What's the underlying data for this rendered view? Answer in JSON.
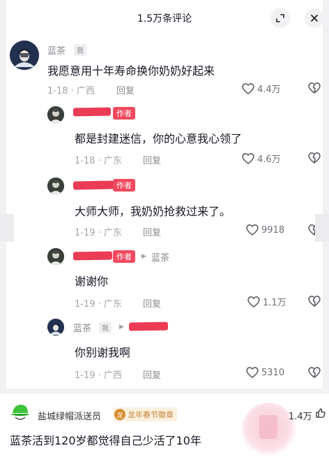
{
  "header": {
    "title": "1.5万条评论",
    "expand_icon": "expand-icon",
    "close_icon": "close-icon"
  },
  "comments": [
    {
      "user": "蓝茶",
      "tag": "我",
      "text": "我愿意用十年寿命换你奶奶好起来",
      "date": "1-18",
      "location": "广西",
      "reply_label": "回复",
      "likes": "4.4万"
    },
    {
      "user_redacted": true,
      "tag": "作者",
      "text": "都是封建迷信，你的心意我心领了",
      "date": "1-18",
      "location": "广东",
      "reply_label": "回复",
      "likes": "4.6万"
    },
    {
      "user_redacted": true,
      "tag": "作者",
      "text": "大师大师，我奶奶抢救过来了。",
      "date": "1-19",
      "location": "广东",
      "reply_label": "回复",
      "likes": "9918"
    },
    {
      "user_redacted": true,
      "tag": "作者",
      "reply_to": "蓝茶",
      "text": "谢谢你",
      "date": "1-19",
      "location": "广东",
      "reply_label": "回复",
      "likes": "1.1万"
    },
    {
      "user": "蓝茶",
      "tag": "我",
      "reply_to_redacted": true,
      "text": "你别谢我啊",
      "date": "1-19",
      "location": "广西",
      "reply_label": "回复",
      "likes": "5310"
    }
  ],
  "bottom_comment": {
    "user": "盐城绿帽派送员",
    "badge": "龙年春节徽章",
    "text": "蓝茶活到120岁都觉得自己少活了10年",
    "likes": "1.4万"
  },
  "colors": {
    "author_tag": "#f0495e",
    "redaction": "#ec3b55",
    "green_avatar": "#3ec43a"
  }
}
